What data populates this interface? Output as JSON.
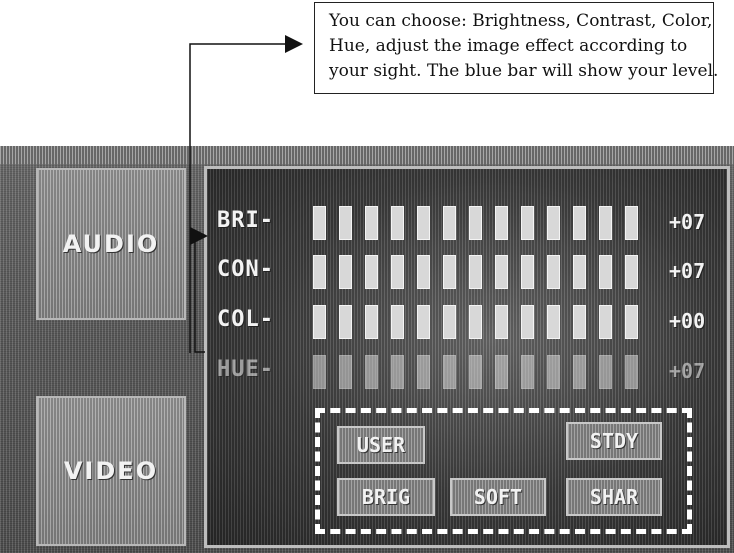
{
  "callout": {
    "lines": [
      "You can choose: Brightness, Contrast, Color,",
      "Hue, adjust the image effect according to",
      "your sight. The blue bar will show your level."
    ]
  },
  "side_tabs": {
    "audio": "AUDIO",
    "video": "VIDEO"
  },
  "adjustments": [
    {
      "label": "BRI-",
      "value": "+07",
      "bars": 13,
      "level": 7
    },
    {
      "label": "CON-",
      "value": "+07",
      "bars": 13,
      "level": 7
    },
    {
      "label": "COL-",
      "value": "+00",
      "bars": 13,
      "level": 0
    },
    {
      "label": "HUE-",
      "value": "+07",
      "bars": 13,
      "level": 7
    }
  ],
  "modes": {
    "user": "USER",
    "stdy": "STDY",
    "brig": "BRIG",
    "soft": "SOFT",
    "shar": "SHAR"
  },
  "colors": {
    "level_bar": "#f6f6f6",
    "highlight_box": "#ffffff"
  }
}
